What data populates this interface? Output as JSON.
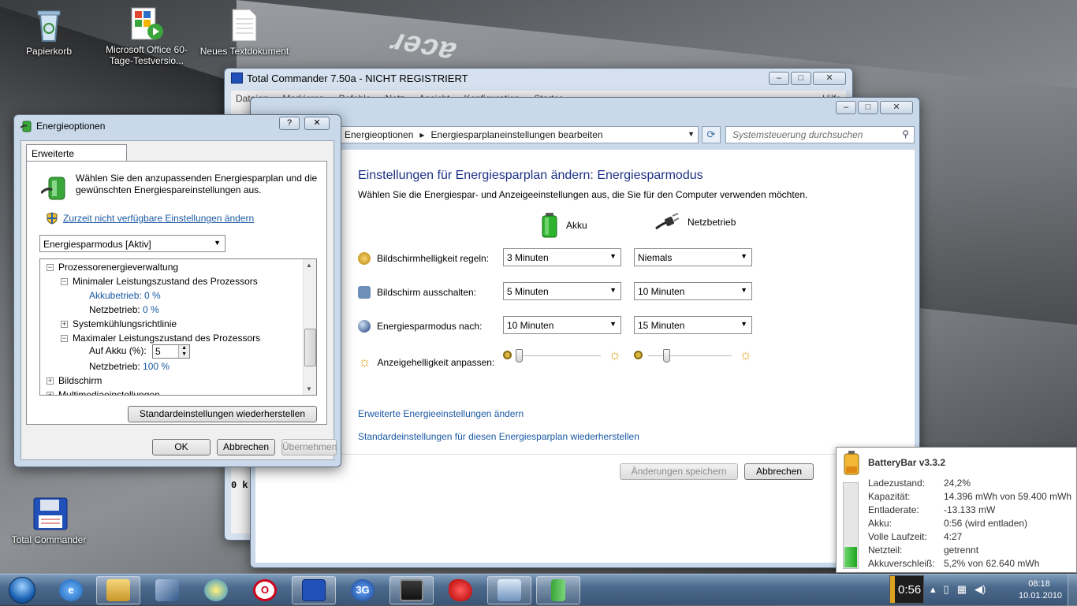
{
  "desktop": {
    "icons": [
      {
        "label": "Papierkorb",
        "icon": "recycle-bin-icon"
      },
      {
        "label": "Microsoft Office 60-Tage-Testversio...",
        "icon": "office-setup-icon"
      },
      {
        "label": "Neues Textdokument",
        "icon": "text-document-icon"
      },
      {
        "label": "Total Commander",
        "icon": "floppy-disk-icon"
      }
    ],
    "brand": "acer"
  },
  "total_commander": {
    "title": "Total Commander 7.50a - NICHT REGISTRIERT",
    "menu": [
      "Dateien",
      "Markieren",
      "Befehle",
      "Netz",
      "Ansicht",
      "Konfiguration",
      "Starter",
      "Hilfe"
    ],
    "partial_text": "0 k"
  },
  "control_panel": {
    "breadcrumb": [
      "Energieoptionen",
      "Energiesparplaneinstellungen bearbeiten"
    ],
    "search_placeholder": "Systemsteuerung durchsuchen",
    "heading": "Einstellungen für Energiesparplan ändern: Energiesparmodus",
    "subheading": "Wählen Sie die Energiespar- und Anzeigeeinstellungen aus, die Sie für den Computer verwenden möchten.",
    "col_battery": "Akku",
    "col_plugged": "Netzbetrieb",
    "rows": [
      {
        "label": "Bildschirmhelligkeit regeln:",
        "battery": "3 Minuten",
        "plugged": "Niemals"
      },
      {
        "label": "Bildschirm ausschalten:",
        "battery": "5 Minuten",
        "plugged": "10 Minuten"
      },
      {
        "label": "Energiesparmodus nach:",
        "battery": "10 Minuten",
        "plugged": "15 Minuten"
      }
    ],
    "brightness_label": "Anzeigehelligkeit anpassen:",
    "brightness_battery": 0.02,
    "brightness_plugged": 0.22,
    "link_advanced": "Erweiterte Energieeinstellungen ändern",
    "link_restore": "Standardeinstellungen für diesen Energiesparplan wiederherstellen",
    "btn_save": "Änderungen speichern",
    "btn_cancel": "Abbrechen"
  },
  "power_options": {
    "title": "Energieoptionen",
    "tab": "Erweiterte Einstellungen",
    "description": "Wählen Sie den anzupassenden Energiesparplan und die gewünschten Energiespareinstellungen aus.",
    "uac_link": "Zurzeit nicht verfügbare Einstellungen ändern",
    "plan": "Energiesparmodus [Aktiv]",
    "tree": {
      "cpu": "Prozessorenergieverwaltung",
      "min_state": "Minimaler Leistungszustand des Prozessors",
      "min_battery_label": "Akkubetrieb:",
      "min_battery_value": "0 %",
      "min_plugged_label": "Netzbetrieb:",
      "min_plugged_value": "0 %",
      "cooling": "Systemkühlungsrichtlinie",
      "max_state": "Maximaler Leistungszustand des Prozessors",
      "max_battery_label": "Auf Akku (%):",
      "max_battery_value": "5",
      "max_plugged_label": "Netzbetrieb:",
      "max_plugged_value": "100 %",
      "display": "Bildschirm",
      "multimedia": "Multimediaeinstellungen"
    },
    "btn_restore": "Standardeinstellungen wiederherstellen",
    "btn_ok": "OK",
    "btn_cancel": "Abbrechen",
    "btn_apply": "Übernehmen"
  },
  "batterybar": {
    "title": "BatteryBar v3.3.2",
    "charge_level": 0.242,
    "rows": [
      {
        "key": "Ladezustand:",
        "value": "24,2%"
      },
      {
        "key": "Kapazität:",
        "value": "14.396 mWh von 59.400 mWh"
      },
      {
        "key": "Entladerate:",
        "value": "-13.133 mW"
      },
      {
        "key": "Akku:",
        "value": "0:56 (wird entladen)"
      },
      {
        "key": "Volle Laufzeit:",
        "value": "4:27"
      },
      {
        "key": "Netzteil:",
        "value": "getrennt"
      },
      {
        "key": "Akkuverschleiß:",
        "value": "5,2% von 62.640 mWh"
      }
    ]
  },
  "taskbar": {
    "battery_time": "0:56",
    "clock_time": "08:18",
    "clock_date": "10.01.2010",
    "apps": [
      "ie-icon",
      "explorer-icon",
      "tool-icon",
      "media-icon",
      "opera-icon",
      "total-commander-icon",
      "3g-icon",
      "monitor-icon",
      "splat-icon",
      "control-panel-icon",
      "power-options-icon"
    ],
    "app_3g_label": "3G"
  },
  "colors": {
    "link": "#1a59a3",
    "heading": "#1e3287",
    "accent": "#d9a320"
  }
}
